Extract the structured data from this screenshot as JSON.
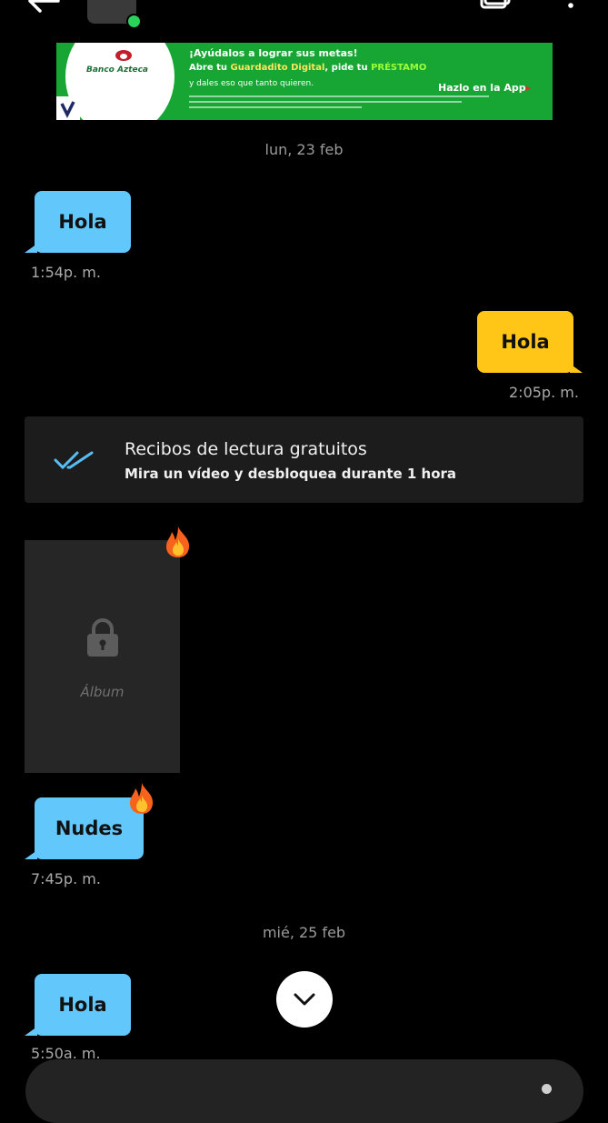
{
  "ad": {
    "brand": "Banco Azteca",
    "line1": "¡Ayúdalos a lograr sus metas!",
    "line2_a": "Abre tu ",
    "line2_b": "Guardadito Digital",
    "line2_c": ", pide tu ",
    "line2_d": "PRÉSTAMO",
    "line3": "y dales eso que tanto quieren.",
    "cta": "Hazlo en la App",
    "cta_arrow": "▸"
  },
  "dates": [
    "lun, 23 feb",
    "mié, 25 feb"
  ],
  "messages": [
    {
      "text": "Hola",
      "time": "1:54p. m."
    },
    {
      "text": "Hola",
      "time": "2:05p. m."
    },
    {
      "text": "Nudes",
      "time": "7:45p. m."
    },
    {
      "text": "Hola",
      "time": "5:50a. m."
    }
  ],
  "promo": {
    "title": "Recibos de lectura gratuitos",
    "subtitle": "Mira un vídeo y desbloquea durante 1 hora"
  },
  "album": {
    "label": "Álbum"
  },
  "icons": {
    "back": "back-arrow-icon",
    "gallery": "gallery-icon",
    "menu": "more-vertical-icon",
    "read_receipt": "double-check-icon",
    "lock": "lock-icon",
    "fire": "fire-icon",
    "scroll_down": "chevron-down-icon"
  },
  "colors": {
    "incoming_bubble": "#62c8fb",
    "outgoing_bubble": "#ffc517",
    "online": "#2ad15b",
    "ad_green": "#17a534"
  }
}
